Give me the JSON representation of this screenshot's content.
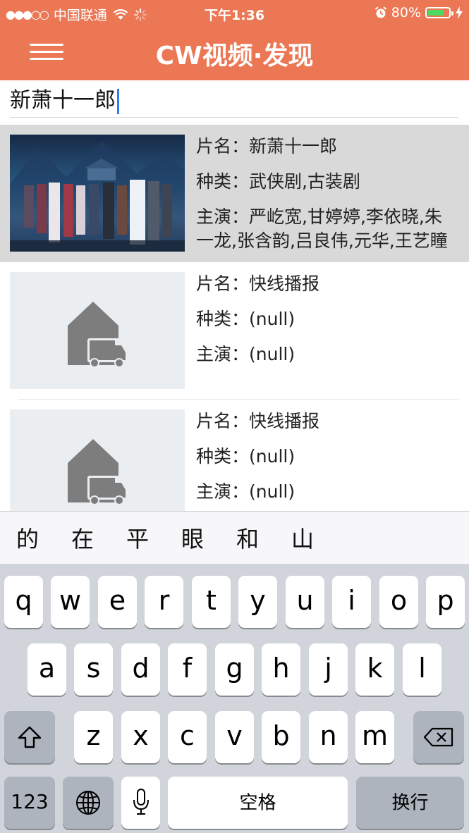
{
  "status": {
    "carrier": "中国联通",
    "signal_dots": "●●●○○",
    "time": "下午1:36",
    "battery": "80%",
    "battery_level": 0.8
  },
  "nav": {
    "title": "CW视频·发现",
    "menu_icon": "hamburger-menu-icon"
  },
  "search": {
    "value": "新萧十一郎"
  },
  "results": [
    {
      "title_label": "片名：",
      "title": "新萧十一郎",
      "genre_label": "种类：",
      "genre": "武侠剧,古装剧",
      "cast_label": "主演：",
      "cast": "严屹宽,甘婷婷,李依晓,朱一龙,张含韵,吕良伟,元华,王艺瞳"
    },
    {
      "title_label": "片名：",
      "title": "快线播报",
      "genre_label": "种类：",
      "genre": "(null)",
      "cast_label": "主演：",
      "cast": "(null)"
    },
    {
      "title_label": "片名：",
      "title": "快线播报",
      "genre_label": "种类：",
      "genre": "(null)",
      "cast_label": "主演：",
      "cast": "(null)"
    }
  ],
  "candidates": [
    "的",
    "在",
    "平",
    "眼",
    "和",
    "山"
  ],
  "keyboard": {
    "row1": [
      "q",
      "w",
      "e",
      "r",
      "t",
      "y",
      "u",
      "i",
      "o",
      "p"
    ],
    "row2": [
      "a",
      "s",
      "d",
      "f",
      "g",
      "h",
      "j",
      "k",
      "l"
    ],
    "row3": [
      "z",
      "x",
      "c",
      "v",
      "b",
      "n",
      "m"
    ],
    "numbers": "123",
    "space": "空格",
    "return": "换行"
  },
  "colors": {
    "accent": "#ec7755",
    "keyboard_bg": "#d1d5db",
    "battery_fill": "#4cd964"
  }
}
